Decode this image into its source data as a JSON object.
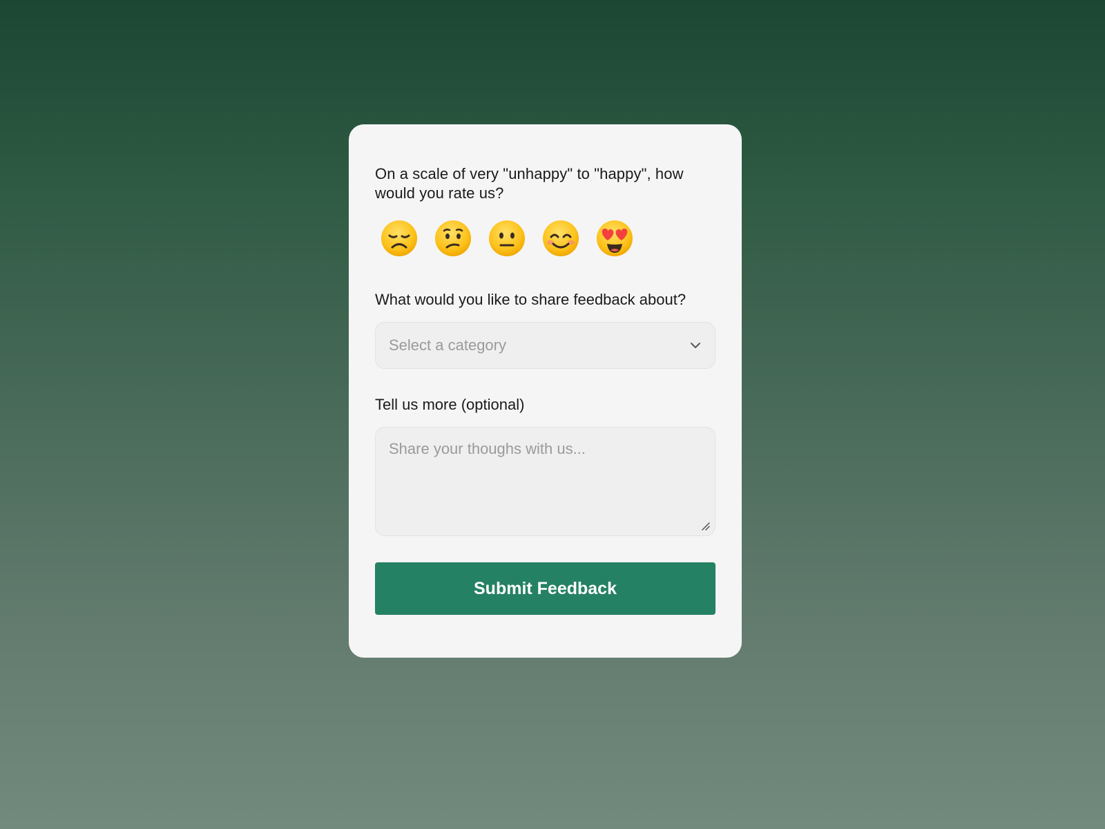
{
  "rating": {
    "question": "On a scale of very \"unhappy\" to \"happy\", how would you rate us?",
    "options": [
      {
        "icon": "disappointed-face-icon",
        "glyph": "😞"
      },
      {
        "icon": "confused-face-icon",
        "glyph": "😕"
      },
      {
        "icon": "neutral-face-icon",
        "glyph": "😐"
      },
      {
        "icon": "smiling-face-icon",
        "glyph": "😊"
      },
      {
        "icon": "heart-eyes-face-icon",
        "glyph": "😍"
      }
    ]
  },
  "category": {
    "label": "What would you like to share feedback about?",
    "placeholder": "Select a category",
    "icon": "chevron-down-icon"
  },
  "details": {
    "label": "Tell us more (optional)",
    "placeholder": "Share your thoughs with us..."
  },
  "submit": {
    "label": "Submit Feedback"
  },
  "colors": {
    "accent": "#258163",
    "card": "#f5f5f5",
    "background_top": "#1b4733",
    "background_bottom": "#728a7e",
    "emoji_face": "#fcc21b"
  }
}
